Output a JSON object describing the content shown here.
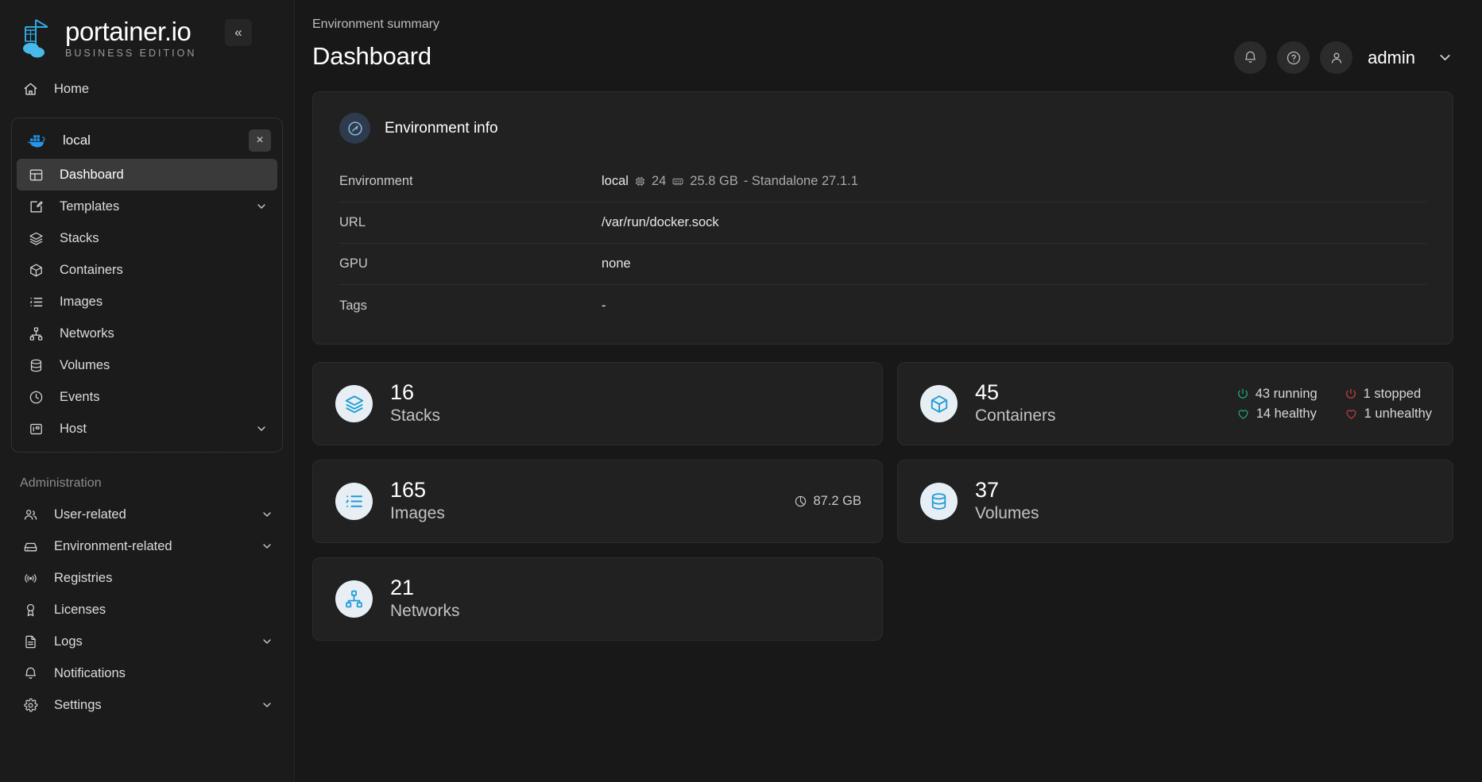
{
  "brand": {
    "title": "portainer.io",
    "subtitle": "BUSINESS EDITION",
    "collapse_label": "«"
  },
  "sidebar": {
    "home": {
      "label": "Home",
      "icon": "home-icon"
    },
    "environment": {
      "name": "local",
      "icon": "docker-icon",
      "close_label": "×",
      "items": [
        {
          "label": "Dashboard",
          "icon": "dashboard-icon",
          "active": true,
          "chevron": ""
        },
        {
          "label": "Templates",
          "icon": "templates-icon",
          "active": false,
          "chevron": "v"
        },
        {
          "label": "Stacks",
          "icon": "stacks-icon",
          "active": false,
          "chevron": ""
        },
        {
          "label": "Containers",
          "icon": "containers-icon",
          "active": false,
          "chevron": ""
        },
        {
          "label": "Images",
          "icon": "images-icon",
          "active": false,
          "chevron": ""
        },
        {
          "label": "Networks",
          "icon": "networks-icon",
          "active": false,
          "chevron": ""
        },
        {
          "label": "Volumes",
          "icon": "volumes-icon",
          "active": false,
          "chevron": ""
        },
        {
          "label": "Events",
          "icon": "events-icon",
          "active": false,
          "chevron": ""
        },
        {
          "label": "Host",
          "icon": "host-icon",
          "active": false,
          "chevron": "v"
        }
      ]
    },
    "administration": {
      "title": "Administration",
      "items": [
        {
          "label": "User-related",
          "icon": "users-icon",
          "chevron": "v"
        },
        {
          "label": "Environment-related",
          "icon": "server-icon",
          "chevron": "v"
        },
        {
          "label": "Registries",
          "icon": "registries-icon",
          "chevron": ""
        },
        {
          "label": "Licenses",
          "icon": "license-icon",
          "chevron": ""
        },
        {
          "label": "Logs",
          "icon": "logs-icon",
          "chevron": "v"
        },
        {
          "label": "Notifications",
          "icon": "bell-icon",
          "chevron": ""
        },
        {
          "label": "Settings",
          "icon": "gear-icon",
          "chevron": "v"
        }
      ]
    }
  },
  "header": {
    "breadcrumb": "Environment summary",
    "title": "Dashboard",
    "notifications_icon": "bell-icon",
    "help_icon": "help-icon",
    "avatar_icon": "user-icon",
    "user": "admin",
    "caret": "chevron-down-icon"
  },
  "environment_info": {
    "panel_title": "Environment info",
    "panel_icon": "gauge-icon",
    "rows": [
      {
        "key": "Environment",
        "value": "local",
        "cpu": "24",
        "memory": "25.8 GB",
        "suffix": "- Standalone 27.1.1"
      },
      {
        "key": "URL",
        "value": "/var/run/docker.sock"
      },
      {
        "key": "GPU",
        "value": "none"
      },
      {
        "key": "Tags",
        "value": "-"
      }
    ]
  },
  "cards": {
    "stacks": {
      "count": "16",
      "label": "Stacks",
      "icon": "stacks-icon"
    },
    "images": {
      "count": "165",
      "label": "Images",
      "icon": "images-icon",
      "size": "87.2 GB",
      "size_icon": "pie-chart-icon"
    },
    "networks": {
      "count": "21",
      "label": "Networks",
      "icon": "networks-icon"
    },
    "containers": {
      "count": "45",
      "label": "Containers",
      "icon": "container-icon",
      "stats": [
        {
          "text": "43 running",
          "icon": "power-icon",
          "tone": "green"
        },
        {
          "text": "1 stopped",
          "icon": "power-icon",
          "tone": "red"
        },
        {
          "text": "14 healthy",
          "icon": "heart-icon",
          "tone": "green"
        },
        {
          "text": "1 unhealthy",
          "icon": "heart-icon",
          "tone": "red"
        }
      ]
    },
    "volumes": {
      "count": "37",
      "label": "Volumes",
      "icon": "volumes-icon"
    }
  },
  "colors": {
    "accent": "#1e9bd7",
    "success": "#1fa97b",
    "danger": "#c24040",
    "bg": "#181818",
    "panel": "#212121"
  }
}
